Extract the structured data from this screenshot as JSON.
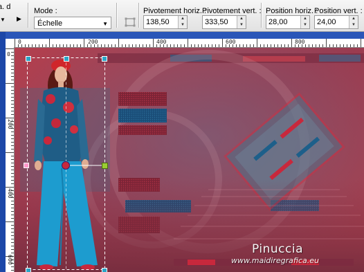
{
  "toolbar": {
    "partial_label": "a. d",
    "mode_label": "Mode :",
    "mode_value": "Échelle",
    "pivot_h_label": "Pivotement horiz. :",
    "pivot_h_value": "138,50",
    "pivot_v_label": "Pivotement vert. :",
    "pivot_v_value": "333,50",
    "pos_h_label": "Position horiz. :",
    "pos_h_value": "28,00",
    "pos_v_label": "Position vert. :",
    "pos_v_value": "24,00"
  },
  "ruler": {
    "top_ticks": [
      "0",
      "200",
      "400",
      "600",
      "800"
    ],
    "left_ticks": [
      "0",
      "200",
      "400",
      "600"
    ]
  },
  "canvas": {
    "watermark_title": "Pinuccia",
    "watermark_url": "www.maidiregrafica.eu"
  },
  "colors": {
    "background_red": "#a73d4e",
    "accent_blue": "#1d5f8a",
    "handle_green": "#9acd32",
    "handle_red": "#c8283c"
  }
}
